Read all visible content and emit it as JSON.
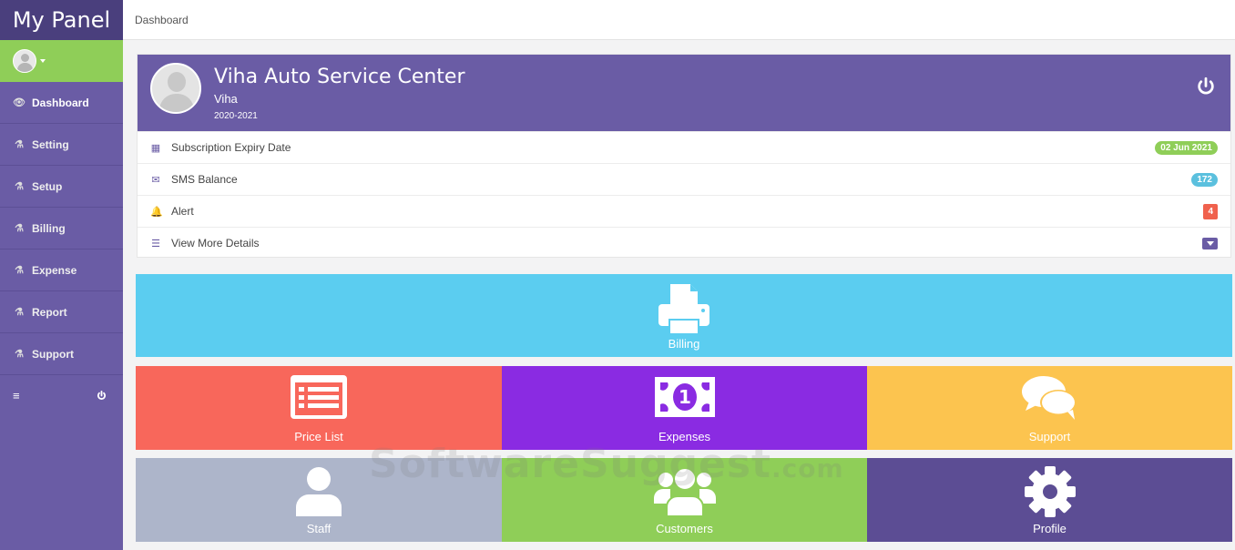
{
  "sidebar": {
    "brand": "My Panel",
    "items": [
      {
        "label": "Dashboard",
        "icon": "eye-icon"
      },
      {
        "label": "Setting",
        "icon": "flask-icon"
      },
      {
        "label": "Setup",
        "icon": "flask-icon"
      },
      {
        "label": "Billing",
        "icon": "flask-icon"
      },
      {
        "label": "Expense",
        "icon": "flask-icon"
      },
      {
        "label": "Report",
        "icon": "flask-icon"
      },
      {
        "label": "Support",
        "icon": "flask-icon"
      }
    ]
  },
  "topbar": {
    "breadcrumb": "Dashboard"
  },
  "profile": {
    "company": "Viha Auto Service Center",
    "owner": "Viha",
    "year": "2020-2021",
    "rows": [
      {
        "label": "Subscription Expiry Date",
        "value": "02 Jun 2021",
        "icon": "calendar-icon"
      },
      {
        "label": "SMS Balance",
        "value": "172",
        "icon": "envelope-icon"
      },
      {
        "label": "Alert",
        "value": "4",
        "icon": "bell-icon"
      },
      {
        "label": "View More Details",
        "icon": "list-icon"
      }
    ]
  },
  "tiles": {
    "billing": "Billing",
    "price_list": "Price List",
    "expenses": "Expenses",
    "support": "Support",
    "staff": "Staff",
    "customers": "Customers",
    "profile": "Profile"
  },
  "watermark": {
    "main": "SoftwareSuggest",
    "suffix": ".com"
  },
  "colors": {
    "sidebar": "#6a5ca5",
    "brand": "#4a3f7d",
    "green": "#8fce58",
    "billing": "#5bcdf0",
    "price_list": "#f8675b",
    "expenses": "#8a2be2",
    "support": "#fcc44f",
    "staff": "#adb5ca",
    "customers": "#8fce58",
    "profile": "#5c4d94"
  }
}
